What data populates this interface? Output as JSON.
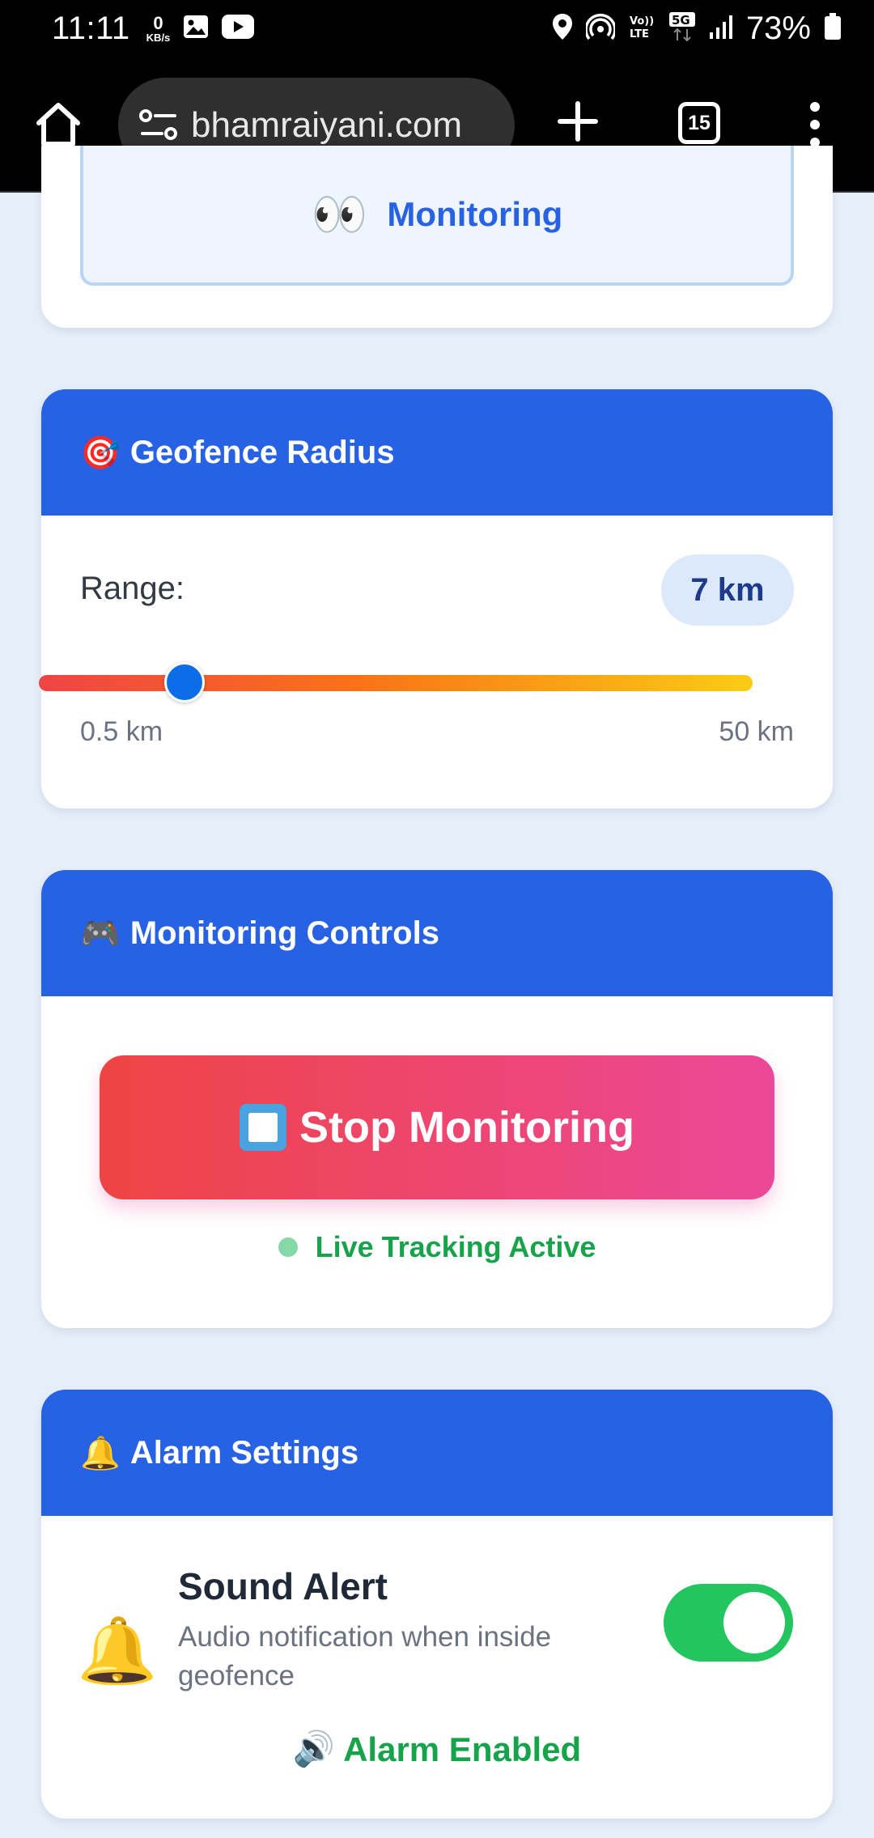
{
  "status_bar": {
    "time": "11:11",
    "net_speed_value": "0",
    "net_speed_unit": "KB/s",
    "battery": "73%",
    "icons": [
      "image-icon",
      "youtube-icon",
      "location-icon",
      "hotspot-icon",
      "volte-icon",
      "5g-icon",
      "signal-icon",
      "battery-icon"
    ]
  },
  "browser": {
    "url": "bhamraiyani.com",
    "tab_count": "15"
  },
  "monitoring_status": {
    "emoji": "👀",
    "text": "Monitoring"
  },
  "geofence": {
    "emoji": "🎯",
    "title": "Geofence Radius",
    "range_label": "Range:",
    "range_value": "7 km",
    "min_label": "0.5 km",
    "max_label": "50 km",
    "slider_value_km": 7,
    "slider_min_km": 0.5,
    "slider_max_km": 50
  },
  "controls": {
    "emoji": "🎮",
    "title": "Monitoring Controls",
    "stop_button": "Stop Monitoring",
    "live_status": "Live Tracking Active"
  },
  "alarm": {
    "emoji": "🔔",
    "title": "Alarm Settings",
    "bell_emoji": "🔔",
    "sound_title": "Sound Alert",
    "sound_desc": "Audio notification when inside geofence",
    "toggle_on": true,
    "speaker_emoji": "🔊",
    "enabled_text": "Alarm Enabled"
  },
  "colors": {
    "header_blue": "#2862e4",
    "accent_green": "#16a34a",
    "stop_gradient_start": "#ef4444",
    "stop_gradient_end": "#ec4899"
  }
}
